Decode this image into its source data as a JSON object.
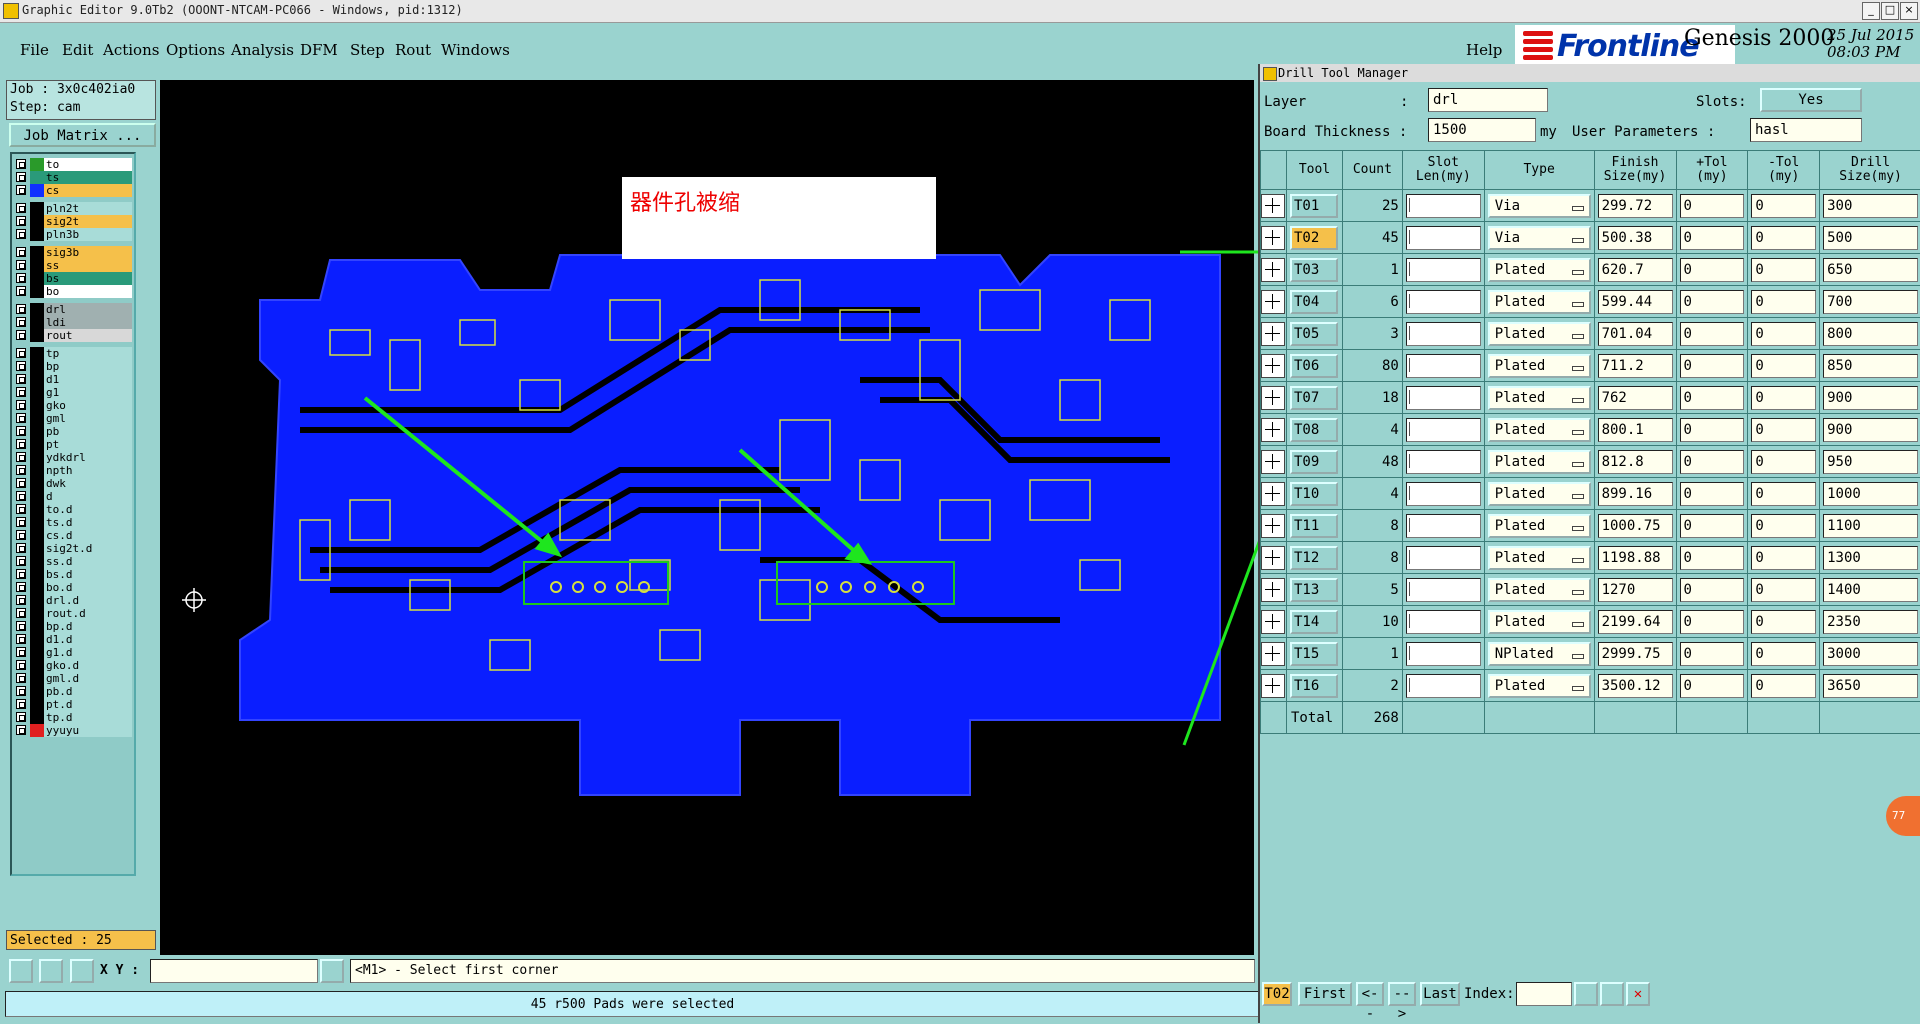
{
  "window": {
    "title": "Graphic Editor 9.0Tb2 (OOONT-NTCAM-PC066 - Windows, pid:1312)"
  },
  "menu": {
    "items": [
      "File",
      "Edit",
      "Actions",
      "Options",
      "Analysis",
      "DFM",
      "Step",
      "Rout",
      "Windows"
    ],
    "help": "Help"
  },
  "brand": {
    "logo_text": "Frontline",
    "product": "Genesis 2000",
    "date": "25 Jul 2015",
    "time": "08:03 PM"
  },
  "job": {
    "job_line": "Job : 3x0c402ia0",
    "step_line": "Step: cam",
    "matrix_button": "Job Matrix ..."
  },
  "layers": [
    {
      "name": "to",
      "color": "#ffffff",
      "swatch": "#2a9a2a"
    },
    {
      "name": "ts",
      "color": "#2a9a7a",
      "swatch": "#2a9a7a"
    },
    {
      "name": "cs",
      "color": "#f5c04a",
      "swatch": "#1030ff"
    },
    {
      "name": "pln2t",
      "color": "#a8dcd8",
      "swatch": "#000000"
    },
    {
      "name": "sig2t",
      "color": "#f5c04a",
      "swatch": "#000000"
    },
    {
      "name": "pln3b",
      "color": "#a8dcd8",
      "swatch": "#000000"
    },
    {
      "name": "sig3b",
      "color": "#f5c04a",
      "swatch": "#000000"
    },
    {
      "name": "ss",
      "color": "#f5c04a",
      "swatch": "#000000"
    },
    {
      "name": "bs",
      "color": "#2a9a7a",
      "swatch": "#000000"
    },
    {
      "name": "bo",
      "color": "#ffffff",
      "swatch": "#000000"
    },
    {
      "name": "drl",
      "color": "#a0b0b0",
      "swatch": "#000000"
    },
    {
      "name": "ldi",
      "color": "#a0b0b0",
      "swatch": "#000000"
    },
    {
      "name": "rout",
      "color": "#d8d8d8",
      "swatch": "#000000"
    },
    {
      "name": "tp",
      "color": "#a8dcd8",
      "swatch": "#000000"
    },
    {
      "name": "bp",
      "color": "#a8dcd8",
      "swatch": "#000000"
    },
    {
      "name": "d1",
      "color": "#a8dcd8",
      "swatch": "#000000"
    },
    {
      "name": "g1",
      "color": "#a8dcd8",
      "swatch": "#000000"
    },
    {
      "name": "gko",
      "color": "#a8dcd8",
      "swatch": "#000000"
    },
    {
      "name": "gml",
      "color": "#a8dcd8",
      "swatch": "#000000"
    },
    {
      "name": "pb",
      "color": "#a8dcd8",
      "swatch": "#000000"
    },
    {
      "name": "pt",
      "color": "#a8dcd8",
      "swatch": "#000000"
    },
    {
      "name": "ydkdrl",
      "color": "#a8dcd8",
      "swatch": "#000000"
    },
    {
      "name": "npth",
      "color": "#a8dcd8",
      "swatch": "#000000"
    },
    {
      "name": "dwk",
      "color": "#a8dcd8",
      "swatch": "#000000"
    },
    {
      "name": "d",
      "color": "#a8dcd8",
      "swatch": "#000000"
    },
    {
      "name": "to.d",
      "color": "#a8dcd8",
      "swatch": "#000000"
    },
    {
      "name": "ts.d",
      "color": "#a8dcd8",
      "swatch": "#000000"
    },
    {
      "name": "cs.d",
      "color": "#a8dcd8",
      "swatch": "#000000"
    },
    {
      "name": "sig2t.d",
      "color": "#a8dcd8",
      "swatch": "#000000"
    },
    {
      "name": "ss.d",
      "color": "#a8dcd8",
      "swatch": "#000000"
    },
    {
      "name": "bs.d",
      "color": "#a8dcd8",
      "swatch": "#000000"
    },
    {
      "name": "bo.d",
      "color": "#a8dcd8",
      "swatch": "#000000"
    },
    {
      "name": "drl.d",
      "color": "#a8dcd8",
      "swatch": "#000000"
    },
    {
      "name": "rout.d",
      "color": "#a8dcd8",
      "swatch": "#000000"
    },
    {
      "name": "bp.d",
      "color": "#a8dcd8",
      "swatch": "#000000"
    },
    {
      "name": "d1.d",
      "color": "#a8dcd8",
      "swatch": "#000000"
    },
    {
      "name": "g1.d",
      "color": "#a8dcd8",
      "swatch": "#000000"
    },
    {
      "name": "gko.d",
      "color": "#a8dcd8",
      "swatch": "#000000"
    },
    {
      "name": "gml.d",
      "color": "#a8dcd8",
      "swatch": "#000000"
    },
    {
      "name": "pb.d",
      "color": "#a8dcd8",
      "swatch": "#000000"
    },
    {
      "name": "pt.d",
      "color": "#a8dcd8",
      "swatch": "#000000"
    },
    {
      "name": "tp.d",
      "color": "#a8dcd8",
      "swatch": "#000000"
    },
    {
      "name": "yyuyu",
      "color": "#a8dcd8",
      "swatch": "#e02020"
    }
  ],
  "selected_text": "Selected : 25",
  "annotation": "器件孔被缩",
  "coords": {
    "label": "X Y :",
    "value": ""
  },
  "prompt": "<M1> - Select first corner",
  "message": "45 r500 Pads were selected",
  "dtm": {
    "title": "Drill Tool Manager",
    "layer_label": "Layer",
    "layer_value": "drl",
    "slots_label": "Slots:",
    "slots_value": "Yes",
    "thickness_label": "Board Thickness :",
    "thickness_value": "1500",
    "thickness_unit": "my",
    "user_params_label": "User Parameters :",
    "user_params_value": "hasl",
    "columns": {
      "tool": "Tool",
      "count": "Count",
      "slot_len": "Slot Len(my)",
      "type": "Type",
      "finish": "Finish Size(my)",
      "ptol": "+Tol (my)",
      "ntol": "-Tol (my)",
      "drill": "Drill Size(my)"
    },
    "rows": [
      {
        "tool": "T01",
        "count": "25",
        "type": "Via",
        "finish": "299.72",
        "ptol": "0",
        "ntol": "0",
        "drill": "300"
      },
      {
        "tool": "T02",
        "count": "45",
        "type": "Via",
        "finish": "500.38",
        "ptol": "0",
        "ntol": "0",
        "drill": "500"
      },
      {
        "tool": "T03",
        "count": "1",
        "type": "Plated",
        "finish": "620.7",
        "ptol": "0",
        "ntol": "0",
        "drill": "650"
      },
      {
        "tool": "T04",
        "count": "6",
        "type": "Plated",
        "finish": "599.44",
        "ptol": "0",
        "ntol": "0",
        "drill": "700"
      },
      {
        "tool": "T05",
        "count": "3",
        "type": "Plated",
        "finish": "701.04",
        "ptol": "0",
        "ntol": "0",
        "drill": "800"
      },
      {
        "tool": "T06",
        "count": "80",
        "type": "Plated",
        "finish": "711.2",
        "ptol": "0",
        "ntol": "0",
        "drill": "850"
      },
      {
        "tool": "T07",
        "count": "18",
        "type": "Plated",
        "finish": "762",
        "ptol": "0",
        "ntol": "0",
        "drill": "900"
      },
      {
        "tool": "T08",
        "count": "4",
        "type": "Plated",
        "finish": "800.1",
        "ptol": "0",
        "ntol": "0",
        "drill": "900"
      },
      {
        "tool": "T09",
        "count": "48",
        "type": "Plated",
        "finish": "812.8",
        "ptol": "0",
        "ntol": "0",
        "drill": "950"
      },
      {
        "tool": "T10",
        "count": "4",
        "type": "Plated",
        "finish": "899.16",
        "ptol": "0",
        "ntol": "0",
        "drill": "1000"
      },
      {
        "tool": "T11",
        "count": "8",
        "type": "Plated",
        "finish": "1000.75",
        "ptol": "0",
        "ntol": "0",
        "drill": "1100"
      },
      {
        "tool": "T12",
        "count": "8",
        "type": "Plated",
        "finish": "1198.88",
        "ptol": "0",
        "ntol": "0",
        "drill": "1300"
      },
      {
        "tool": "T13",
        "count": "5",
        "type": "Plated",
        "finish": "1270",
        "ptol": "0",
        "ntol": "0",
        "drill": "1400"
      },
      {
        "tool": "T14",
        "count": "10",
        "type": "Plated",
        "finish": "2199.64",
        "ptol": "0",
        "ntol": "0",
        "drill": "2350"
      },
      {
        "tool": "T15",
        "count": "1",
        "type": "NPlated",
        "finish": "2999.75",
        "ptol": "0",
        "ntol": "0",
        "drill": "3000"
      },
      {
        "tool": "T16",
        "count": "2",
        "type": "Plated",
        "finish": "3500.12",
        "ptol": "0",
        "ntol": "0",
        "drill": "3650"
      }
    ],
    "total_label": "Total",
    "total_value": "268",
    "current_tool": "T02",
    "nav": {
      "first": "First",
      "prev": "<--",
      "next": "-->",
      "last": "Last",
      "index_label": "Index:"
    }
  }
}
